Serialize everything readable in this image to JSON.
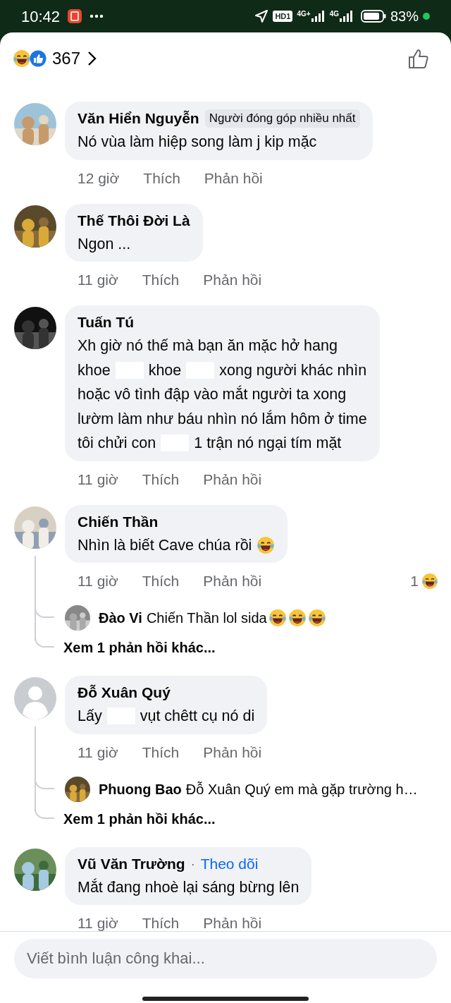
{
  "status_bar": {
    "time": "10:42",
    "network": [
      "HD1",
      "4G+",
      "4G"
    ],
    "battery": "83%"
  },
  "header": {
    "reaction_count": "367"
  },
  "comments": [
    {
      "author": "Văn Hiển Nguyễn",
      "badge": "Người đóng góp nhiều nhất",
      "avatar": {
        "kind": "picture"
      },
      "body": [
        [
          {
            "kind": "text",
            "text": "Nó vùa làm hiệp song làm j kip mặc"
          }
        ]
      ],
      "time": "12 giờ",
      "like": "Thích",
      "reply": "Phản hồi"
    },
    {
      "author": "Thế Thôi Đời Là",
      "avatar": {
        "kind": "picture"
      },
      "body": [
        [
          {
            "kind": "text",
            "text": "Ngon ..."
          }
        ]
      ],
      "time": "11 giờ",
      "like": "Thích",
      "reply": "Phản hồi"
    },
    {
      "author": "Tuấn Tú",
      "avatar": {
        "kind": "picture"
      },
      "body": [
        [
          {
            "kind": "text",
            "text": "Xh giờ nó thế mà bạn ăn mặc hở hang"
          }
        ],
        [
          {
            "kind": "text",
            "text": "khoe"
          },
          {
            "kind": "redacted"
          },
          {
            "kind": "text",
            "text": "khoe"
          },
          {
            "kind": "redacted"
          },
          {
            "kind": "text",
            "text": "xong người khác nhìn"
          }
        ],
        [
          {
            "kind": "text",
            "text": "hoặc vô tình đập vào mắt người ta xong"
          }
        ],
        [
          {
            "kind": "text",
            "text": "lườm làm như báu nhìn nó lắm hôm ở time"
          }
        ],
        [
          {
            "kind": "text",
            "text": "tôi chửi con"
          },
          {
            "kind": "redacted"
          },
          {
            "kind": "text",
            "text": "1 trận nó ngại tím mặt"
          }
        ]
      ],
      "time": "11 giờ",
      "like": "Thích",
      "reply": "Phản hồi"
    },
    {
      "author": "Chiến Thần",
      "avatar": {
        "kind": "picture"
      },
      "body": [
        [
          {
            "kind": "text",
            "text": "Nhìn là biết Cave chúa rồi"
          },
          {
            "kind": "emoji"
          }
        ]
      ],
      "time": "11 giờ",
      "like": "Thích",
      "reply": "Phản hồi",
      "reaction_count": "1",
      "replies": [
        {
          "author": "Đào Vi",
          "body": [
            {
              "kind": "text",
              "text": "Chiến Thần lol sida"
            },
            {
              "kind": "emoji"
            },
            {
              "kind": "emoji"
            },
            {
              "kind": "emoji"
            }
          ]
        }
      ],
      "more_replies": "Xem 1 phản hồi khác..."
    },
    {
      "author": "Đỗ Xuân Quý",
      "avatar": {
        "kind": "default"
      },
      "body": [
        [
          {
            "kind": "text",
            "text": "Lấy"
          },
          {
            "kind": "redacted"
          },
          {
            "kind": "text",
            "text": "vụt chêtt cụ nó di"
          }
        ]
      ],
      "time": "11 giờ",
      "like": "Thích",
      "reply": "Phản hồi",
      "replies": [
        {
          "author": "Phuong Bao",
          "body": [
            {
              "kind": "text",
              "text": "Đỗ Xuân Quý em mà gặp trường h…"
            }
          ]
        }
      ],
      "more_replies": "Xem 1 phản hồi khác..."
    },
    {
      "author": "Vũ Văn Trường",
      "separator": "·",
      "follow": "Theo dõi",
      "avatar": {
        "kind": "picture"
      },
      "body": [
        [
          {
            "kind": "text",
            "text": "Mắt đang nhoè lại sáng bừng lên"
          }
        ]
      ],
      "time": "11 giờ",
      "like": "Thích",
      "reply": "Phản hồi"
    }
  ],
  "composer": {
    "placeholder": "Viết bình luận công khai..."
  }
}
